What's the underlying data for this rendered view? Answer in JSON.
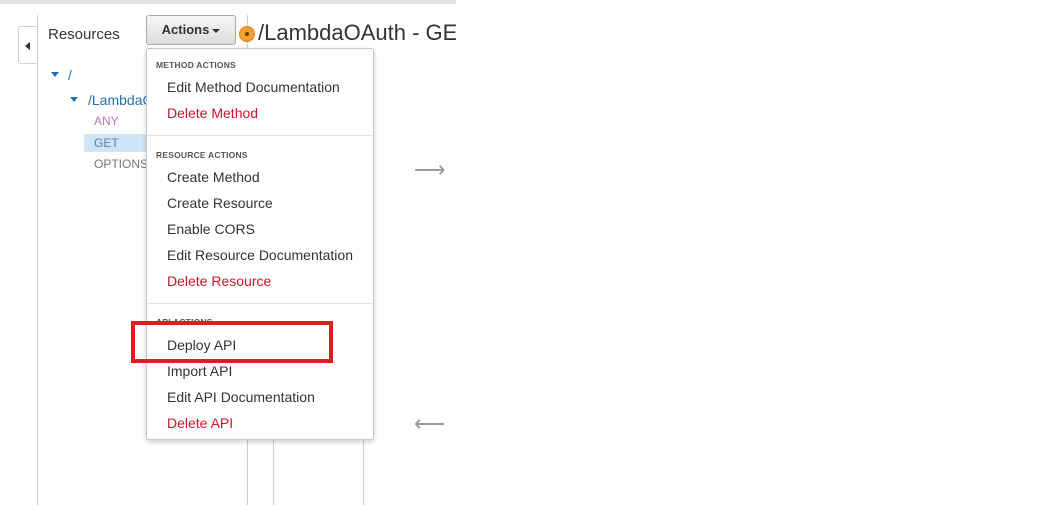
{
  "resources_panel": {
    "title": "Resources",
    "actions_label": "Actions",
    "tree": {
      "root": "/",
      "child": "/LambdaOAuth",
      "methods": [
        "ANY",
        "GET",
        "OPTIONS"
      ],
      "selected_method": "GET"
    }
  },
  "method_header": {
    "title": "/LambdaOAuth - GET - Method Execution"
  },
  "actions_menu": {
    "method_actions_header": "METHOD ACTIONS",
    "method_items": [
      {
        "label": "Edit Method Documentation",
        "style": "normal"
      },
      {
        "label": "Delete Method",
        "style": "danger"
      }
    ],
    "resource_actions_header": "RESOURCE ACTIONS",
    "resource_items": [
      {
        "label": "Create Method",
        "style": "normal"
      },
      {
        "label": "Create Resource",
        "style": "normal"
      },
      {
        "label": "Enable CORS",
        "style": "normal"
      },
      {
        "label": "Edit Resource Documentation",
        "style": "normal"
      },
      {
        "label": "Delete Resource",
        "style": "danger"
      }
    ],
    "api_actions_header": "API ACTIONS",
    "api_items": [
      {
        "label": "Deploy API",
        "style": "normal"
      },
      {
        "label": "Import API",
        "style": "normal"
      },
      {
        "label": "Edit API Documentation",
        "style": "normal"
      },
      {
        "label": "Delete API",
        "style": "danger"
      }
    ]
  },
  "icons": {
    "collapse": "caret-left-icon",
    "arrow_right": "arrow-right-icon",
    "arrow_left": "arrow-left-icon",
    "method_status": "orange-dot-icon"
  },
  "colors": {
    "danger": "#c7182a",
    "highlight": "#e21b22",
    "link": "#2a6fa8",
    "selected_bg": "#cfe5f7"
  }
}
